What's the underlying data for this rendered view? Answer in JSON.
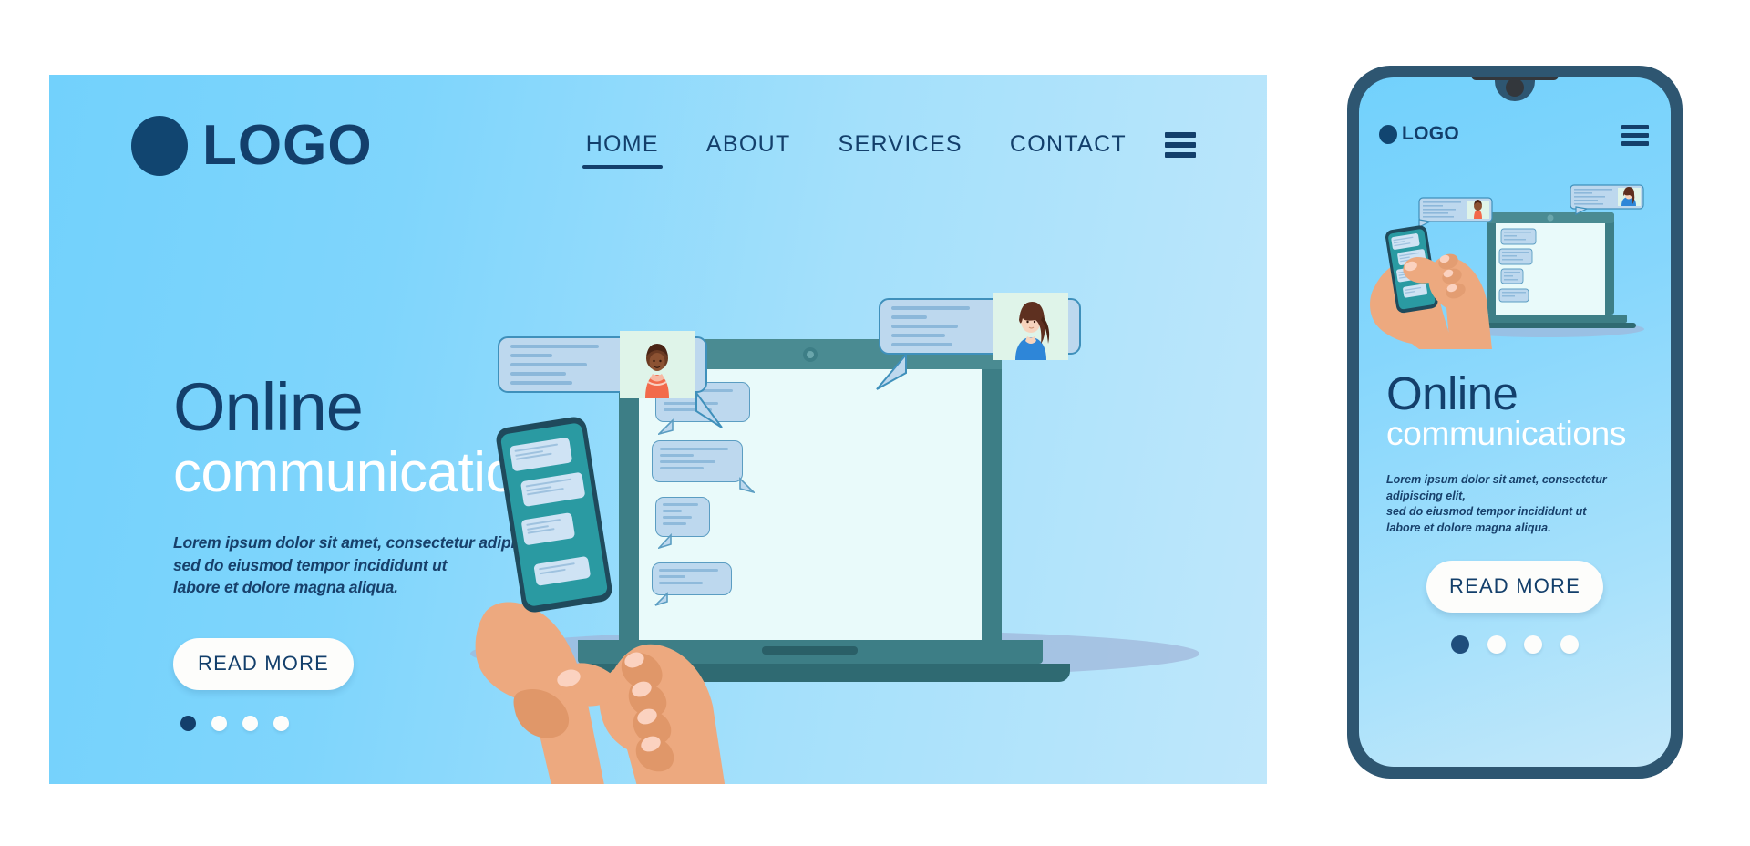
{
  "brand": {
    "logo_text": "LOGO",
    "logo_icon": "circle-dot-icon",
    "navy": "#133f6b",
    "sky": "#72d1fc",
    "sky_light": "#c4e8fa",
    "teal": "#3d7e86",
    "button_bg": "#fdfdfb"
  },
  "desktop": {
    "nav": {
      "items": [
        {
          "label": "HOME",
          "active": true
        },
        {
          "label": "ABOUT",
          "active": false
        },
        {
          "label": "SERVICES",
          "active": false
        },
        {
          "label": "CONTACT",
          "active": false
        }
      ],
      "menu_icon": "hamburger-menu-icon"
    },
    "hero": {
      "title": "Online",
      "subtitle": "communications",
      "body": "Lorem ipsum dolor sit amet, consectetur adipiscing elit,\nsed do eiusmod tempor incididunt ut\nlabore et dolore magna aliqua.",
      "body_lines": [
        "Lorem ipsum dolor sit amet, consectetur adipiscing elit,",
        "sed do eiusmod tempor incididunt ut",
        "labore et dolore magna aliqua."
      ],
      "cta_label": "READ MORE",
      "carousel": {
        "count": 4,
        "active_index": 0
      }
    },
    "illustration": {
      "name": "online-chat-illustration",
      "devices": [
        "laptop-with-chat-screen",
        "smartphone-in-hands"
      ],
      "floating_messages": [
        {
          "id": "message-bubble-left",
          "avatar": "woman-avatar-orange-dress"
        },
        {
          "id": "message-bubble-right",
          "avatar": "woman-avatar-blue-sweater"
        }
      ],
      "laptop_bubbles": 4,
      "phone_bubbles": 4
    }
  },
  "mobile": {
    "logo_text": "LOGO",
    "menu_icon": "hamburger-menu-icon",
    "hero": {
      "title": "Online",
      "subtitle": "communications",
      "body_lines": [
        "Lorem ipsum dolor sit amet, consectetur adipiscing elit,",
        "sed do eiusmod tempor incididunt ut",
        "labore et dolore magna aliqua."
      ],
      "cta_label": "READ MORE",
      "carousel": {
        "count": 4,
        "active_index": 0
      }
    }
  }
}
